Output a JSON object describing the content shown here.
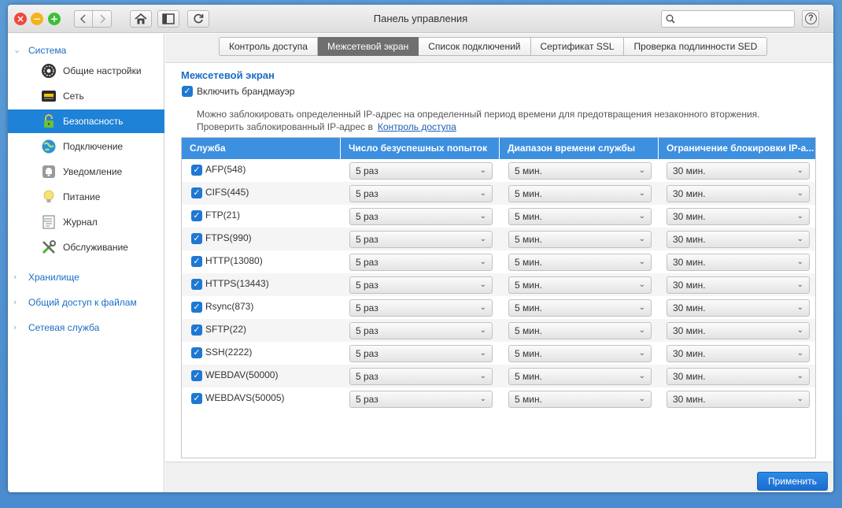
{
  "window": {
    "title": "Панель управления"
  },
  "search": {
    "placeholder": ""
  },
  "sidebar": {
    "groups": [
      {
        "label": "Система",
        "expanded": true
      },
      {
        "label": "Хранилище",
        "expanded": false
      },
      {
        "label": "Общий доступ к файлам",
        "expanded": false
      },
      {
        "label": "Сетевая служба",
        "expanded": false
      }
    ],
    "items": [
      {
        "label": "Общие настройки",
        "icon": "gear-icon"
      },
      {
        "label": "Сеть",
        "icon": "network-icon"
      },
      {
        "label": "Безопасность",
        "icon": "lock-icon",
        "active": true
      },
      {
        "label": "Подключение",
        "icon": "globe-icon"
      },
      {
        "label": "Уведомление",
        "icon": "notification-icon"
      },
      {
        "label": "Питание",
        "icon": "lightbulb-icon"
      },
      {
        "label": "Журнал",
        "icon": "log-icon"
      },
      {
        "label": "Обслуживание",
        "icon": "tools-icon"
      }
    ]
  },
  "tabs": [
    {
      "label": "Контроль доступа"
    },
    {
      "label": "Межсетевой экран",
      "active": true
    },
    {
      "label": "Список подключений"
    },
    {
      "label": "Сертификат SSL"
    },
    {
      "label": "Проверка подлинности SED"
    }
  ],
  "firewall": {
    "title": "Межсетевой экран",
    "enable_label": "Включить брандмауэр",
    "enable_checked": true,
    "description": "Можно заблокировать определенный IP-адрес на определенный период времени для предотвращения незаконного вторжения.",
    "check_text": "Проверить заблокированный IP-адрес в",
    "check_link": "Контроль доступа"
  },
  "table": {
    "headers": [
      "Служба",
      "Число безуспешных попыток",
      "Диапазон времени службы",
      "Ограничение блокировки IP-а..."
    ],
    "rows": [
      {
        "service": "AFP(548)",
        "attempts": "5 раз",
        "range": "5 мин.",
        "block": "30 мин."
      },
      {
        "service": "CIFS(445)",
        "attempts": "5 раз",
        "range": "5 мин.",
        "block": "30 мин."
      },
      {
        "service": "FTP(21)",
        "attempts": "5 раз",
        "range": "5 мин.",
        "block": "30 мин."
      },
      {
        "service": "FTPS(990)",
        "attempts": "5 раз",
        "range": "5 мин.",
        "block": "30 мин."
      },
      {
        "service": "HTTP(13080)",
        "attempts": "5 раз",
        "range": "5 мин.",
        "block": "30 мин."
      },
      {
        "service": "HTTPS(13443)",
        "attempts": "5 раз",
        "range": "5 мин.",
        "block": "30 мин."
      },
      {
        "service": "Rsync(873)",
        "attempts": "5 раз",
        "range": "5 мин.",
        "block": "30 мин."
      },
      {
        "service": "SFTP(22)",
        "attempts": "5 раз",
        "range": "5 мин.",
        "block": "30 мин."
      },
      {
        "service": "SSH(2222)",
        "attempts": "5 раз",
        "range": "5 мин.",
        "block": "30 мин."
      },
      {
        "service": "WEBDAV(50000)",
        "attempts": "5 раз",
        "range": "5 мин.",
        "block": "30 мин."
      },
      {
        "service": "WEBDAVS(50005)",
        "attempts": "5 раз",
        "range": "5 мин.",
        "block": "30 мин."
      }
    ]
  },
  "footer": {
    "apply_label": "Применить"
  },
  "colors": {
    "accent": "#1e82d7",
    "header": "#3d8fe0",
    "link": "#1a6dc4"
  }
}
